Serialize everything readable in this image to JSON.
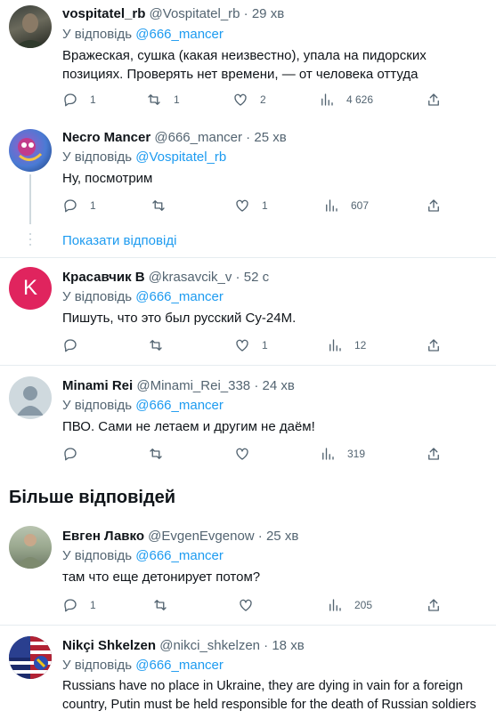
{
  "reply_prefix": "У відповідь",
  "tweets": [
    {
      "name": "vospitatel_rb",
      "handle": "@Vospitatel_rb",
      "time": "29 хв",
      "reply_to": "@666_mancer",
      "text": "Вражеская, сушка (какая неизвестно), упала на пидорских позициях. Проверять нет времени, — от человека оттуда",
      "replies": "1",
      "retweets": "1",
      "likes": "2",
      "views": "4 626"
    },
    {
      "name": "Necro Mancer",
      "handle": "@666_mancer",
      "time": "25 хв",
      "reply_to": "@Vospitatel_rb",
      "text": "Ну, посмотрим",
      "replies": "1",
      "retweets": "",
      "likes": "1",
      "views": "607"
    },
    {
      "name": "Красавчик В",
      "handle": "@krasavcik_v",
      "time": "52 с",
      "reply_to": "@666_mancer",
      "text": "Пишуть, что это был русский Су-24М.",
      "replies": "",
      "retweets": "",
      "likes": "1",
      "views": "12",
      "avatar_letter": "K"
    },
    {
      "name": "Minami Rei",
      "handle": "@Minami_Rei_338",
      "time": "24 хв",
      "reply_to": "@666_mancer",
      "text": "ПВО. Сами не летаем и другим не даём!",
      "replies": "",
      "retweets": "",
      "likes": "",
      "views": "319"
    },
    {
      "name": "Евген Лавко",
      "handle": "@EvgenEvgenow",
      "time": "25 хв",
      "reply_to": "@666_mancer",
      "text": "там что еще детонирует потом?",
      "replies": "1",
      "retweets": "",
      "likes": "",
      "views": "205"
    },
    {
      "name": "Nikçi Shkelzen",
      "handle": "@nikci_shkelzen",
      "time": "18 хв",
      "reply_to": "@666_mancer",
      "text": "Russians have no place in Ukraine, they are dying in vain for a foreign country, Putin must be held responsible for the death of Russian soldiers",
      "replies": "",
      "retweets": "",
      "likes": "",
      "views": ""
    }
  ],
  "show_replies": "Показати відповіді",
  "more_replies_title": "Більше відповідей",
  "colors": {
    "link": "#1d9bf0",
    "muted": "#536471",
    "avatar_krasavcik": "#e0245e"
  }
}
